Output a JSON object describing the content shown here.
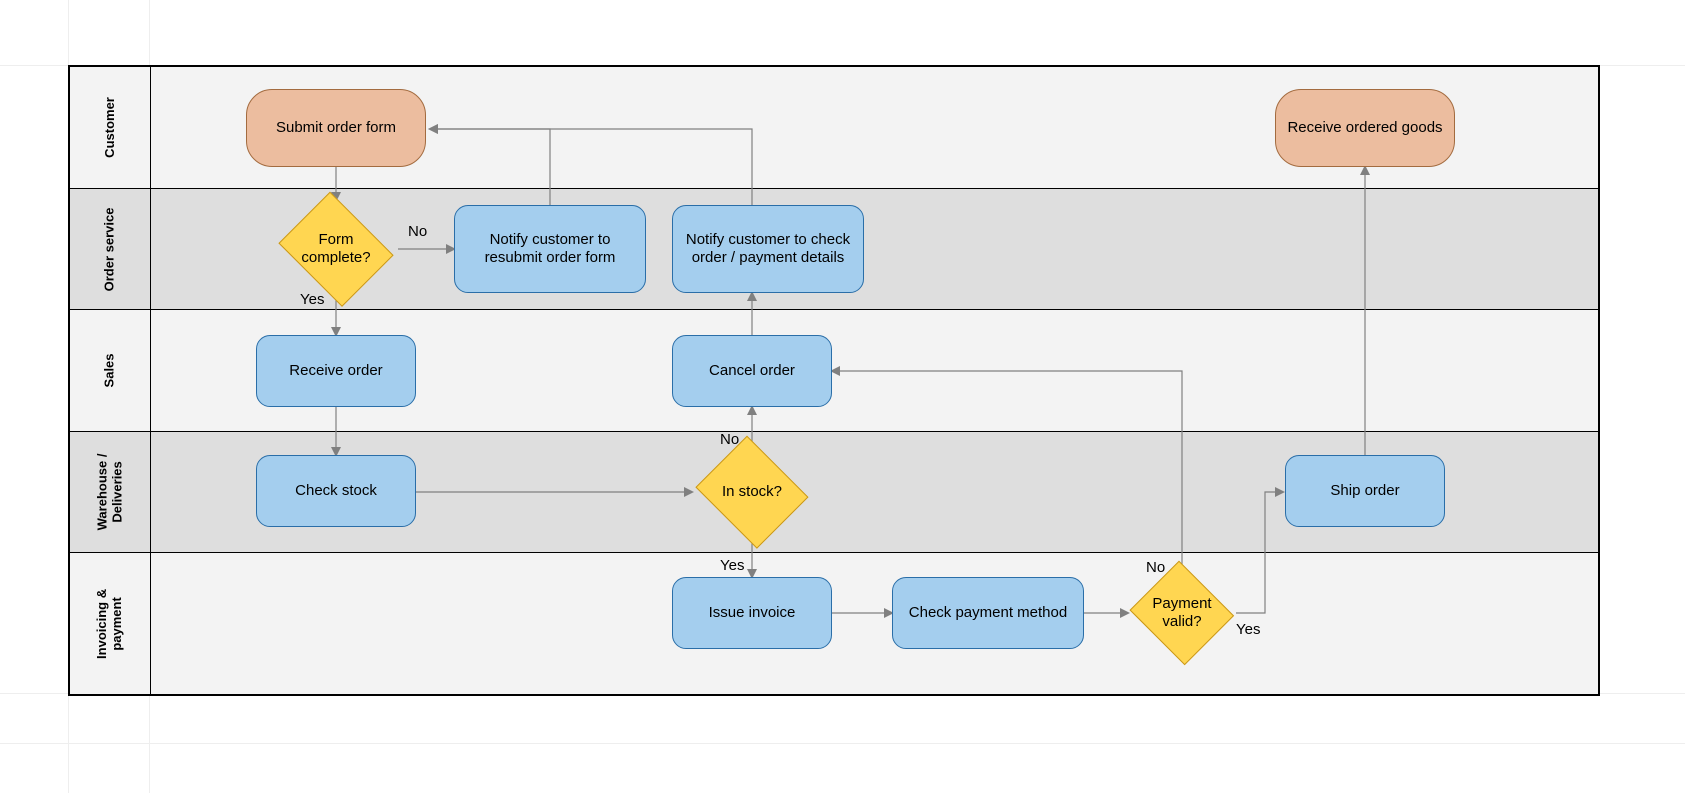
{
  "lanes": {
    "customer": "Customer",
    "order_service": "Order service",
    "sales": "Sales",
    "warehouse": "Warehouse /\nDeliveries",
    "invoicing": "Invoicing &\npayment"
  },
  "nodes": {
    "submit_order": "Submit order form",
    "receive_goods": "Receive ordered goods",
    "form_complete_q": "Form complete?",
    "notify_resubmit": "Notify customer to resubmit order form",
    "notify_check": "Notify customer to check order / payment details",
    "receive_order": "Receive order",
    "cancel_order": "Cancel order",
    "check_stock": "Check stock",
    "in_stock_q": "In stock?",
    "ship_order": "Ship order",
    "issue_invoice": "Issue invoice",
    "check_payment": "Check payment method",
    "payment_valid_q": "Payment valid?"
  },
  "labels": {
    "yes": "Yes",
    "no": "No"
  }
}
